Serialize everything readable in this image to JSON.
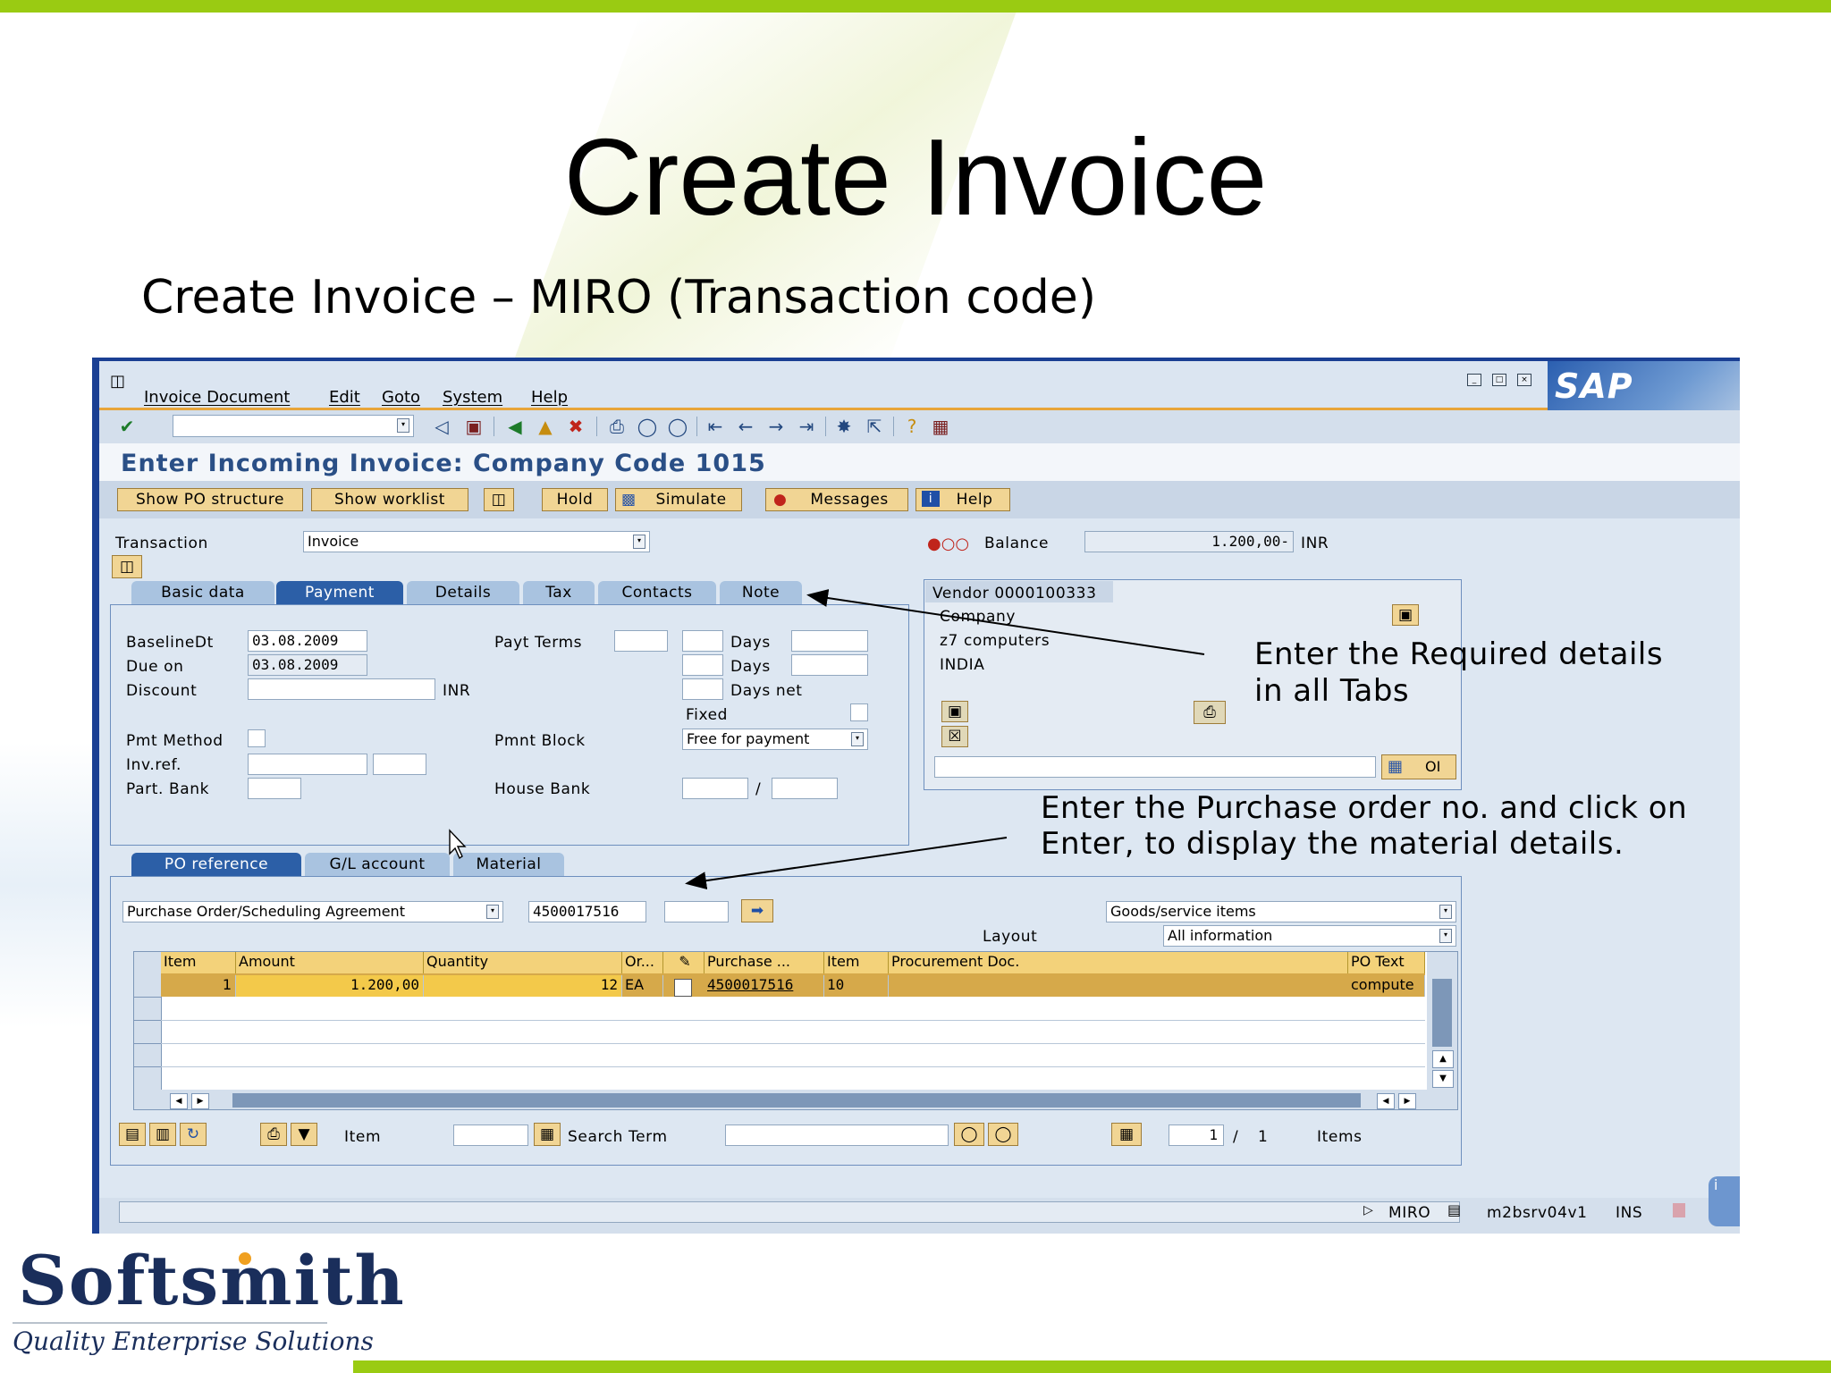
{
  "slide": {
    "title": "Create Invoice",
    "subtitle": "Create Invoice – MIRO (Transaction code)",
    "logo_name": "Softsmith",
    "logo_tagline": "Quality Enterprise Solutions"
  },
  "menu": [
    "Invoice Document",
    "Edit",
    "Goto",
    "System",
    "Help"
  ],
  "sap_logo": "SAP",
  "screen_title": "Enter Incoming Invoice: Company Code 1015",
  "app_buttons": {
    "show_po": "Show PO structure",
    "show_worklist": "Show worklist",
    "hold": "Hold",
    "simulate": "Simulate",
    "messages": "Messages",
    "help": "Help"
  },
  "header": {
    "transaction_label": "Transaction",
    "transaction_value": "Invoice",
    "balance_label": "Balance",
    "balance_value": "1.200,00-",
    "balance_currency": "INR"
  },
  "tabs": [
    "Basic data",
    "Payment",
    "Details",
    "Tax",
    "Contacts",
    "Note"
  ],
  "active_tab": "Payment",
  "payment": {
    "baseline_label": "BaselineDt",
    "baseline_value": "03.08.2009",
    "due_label": "Due on",
    "due_value": "03.08.2009",
    "discount_label": "Discount",
    "discount_currency": "INR",
    "pmt_method_label": "Pmt Method",
    "invref_label": "Inv.ref.",
    "partbank_label": "Part. Bank",
    "payt_terms_label": "Payt Terms",
    "days1": "Days",
    "days2": "Days",
    "days_net": "Days net",
    "fixed": "Fixed",
    "pmnt_block_label": "Pmnt Block",
    "pmnt_block_value": "Free for payment",
    "house_bank_label": "House Bank",
    "slash": "/"
  },
  "vendor": {
    "title": "Vendor 0000100333",
    "line1": "Company",
    "line2": "z7 computers",
    "line3": "INDIA",
    "oi": "OI"
  },
  "bottom_tabs": [
    "PO reference",
    "G/L account",
    "Material"
  ],
  "po": {
    "ref_type": "Purchase Order/Scheduling Agreement",
    "po_number": "4500017516",
    "goods_select": "Goods/service items",
    "layout_label": "Layout",
    "layout_value": "All information"
  },
  "grid": {
    "columns": [
      "Item",
      "Amount",
      "Quantity",
      "Or...",
      "",
      "Purchase ...",
      "Item",
      "Procurement Doc.",
      "PO Text"
    ],
    "rows": [
      {
        "item": "1",
        "amount": "1.200,00",
        "quantity": "12",
        "uom": "EA",
        "purchase": "4500017516",
        "po_item": "10",
        "po_text": "compute"
      }
    ]
  },
  "grid_footer": {
    "item_label": "Item",
    "search_label": "Search Term",
    "page_current": "1",
    "page_sep": "/",
    "page_total": "1",
    "items_label": "Items"
  },
  "status": {
    "tcode": "MIRO",
    "server": "m2bsrv04v1",
    "mode": "INS"
  },
  "annotations": {
    "a1_line1": "Enter the Required details",
    "a1_line2": "in all Tabs",
    "a2_line1": "Enter the Purchase order no. and click on",
    "a2_line2": "Enter, to display the material details."
  },
  "colors": {
    "accent_green": "#9acb12",
    "sap_frame": "#1a3f93",
    "button_gold": "#f1d594",
    "selected_row": "#d6a94a",
    "logo_navy": "#1a2e5b"
  }
}
